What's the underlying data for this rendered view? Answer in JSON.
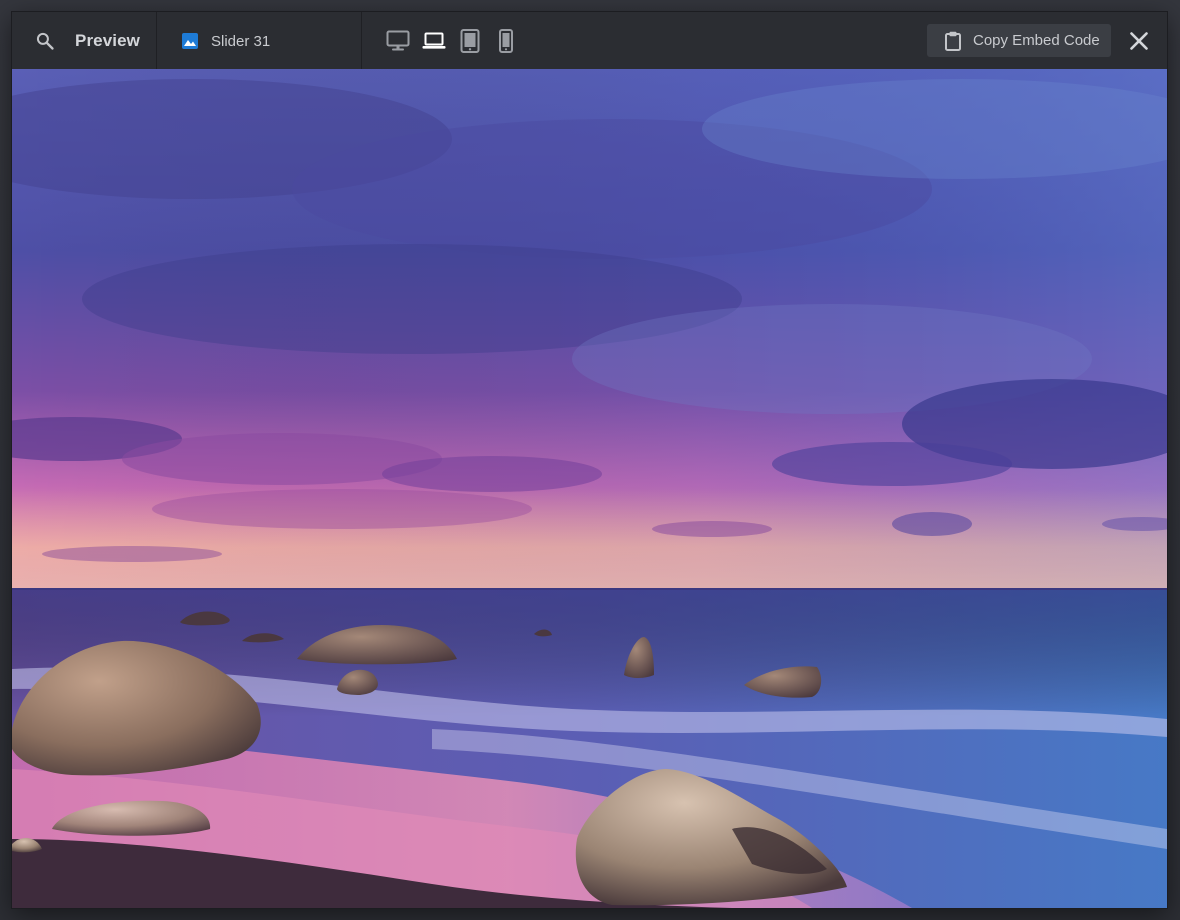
{
  "toolbar": {
    "title": "Preview",
    "slider_name": "Slider 31",
    "copy_embed_label": "Copy Embed Code",
    "devices": [
      {
        "icon": "desktop-icon",
        "active": false
      },
      {
        "icon": "laptop-icon",
        "active": true
      },
      {
        "icon": "tablet-icon",
        "active": false
      },
      {
        "icon": "phone-icon",
        "active": false
      }
    ]
  },
  "colors": {
    "toolbar_bg": "#2b2d32",
    "icon": "#c3c5c9",
    "icon_active": "#ffffff",
    "slider_icon_accent": "#1e7bd6",
    "button_bg": "#3b3e44"
  },
  "preview": {
    "content": "slide image: seaside sunset with purple sky and rocks on the shore"
  }
}
